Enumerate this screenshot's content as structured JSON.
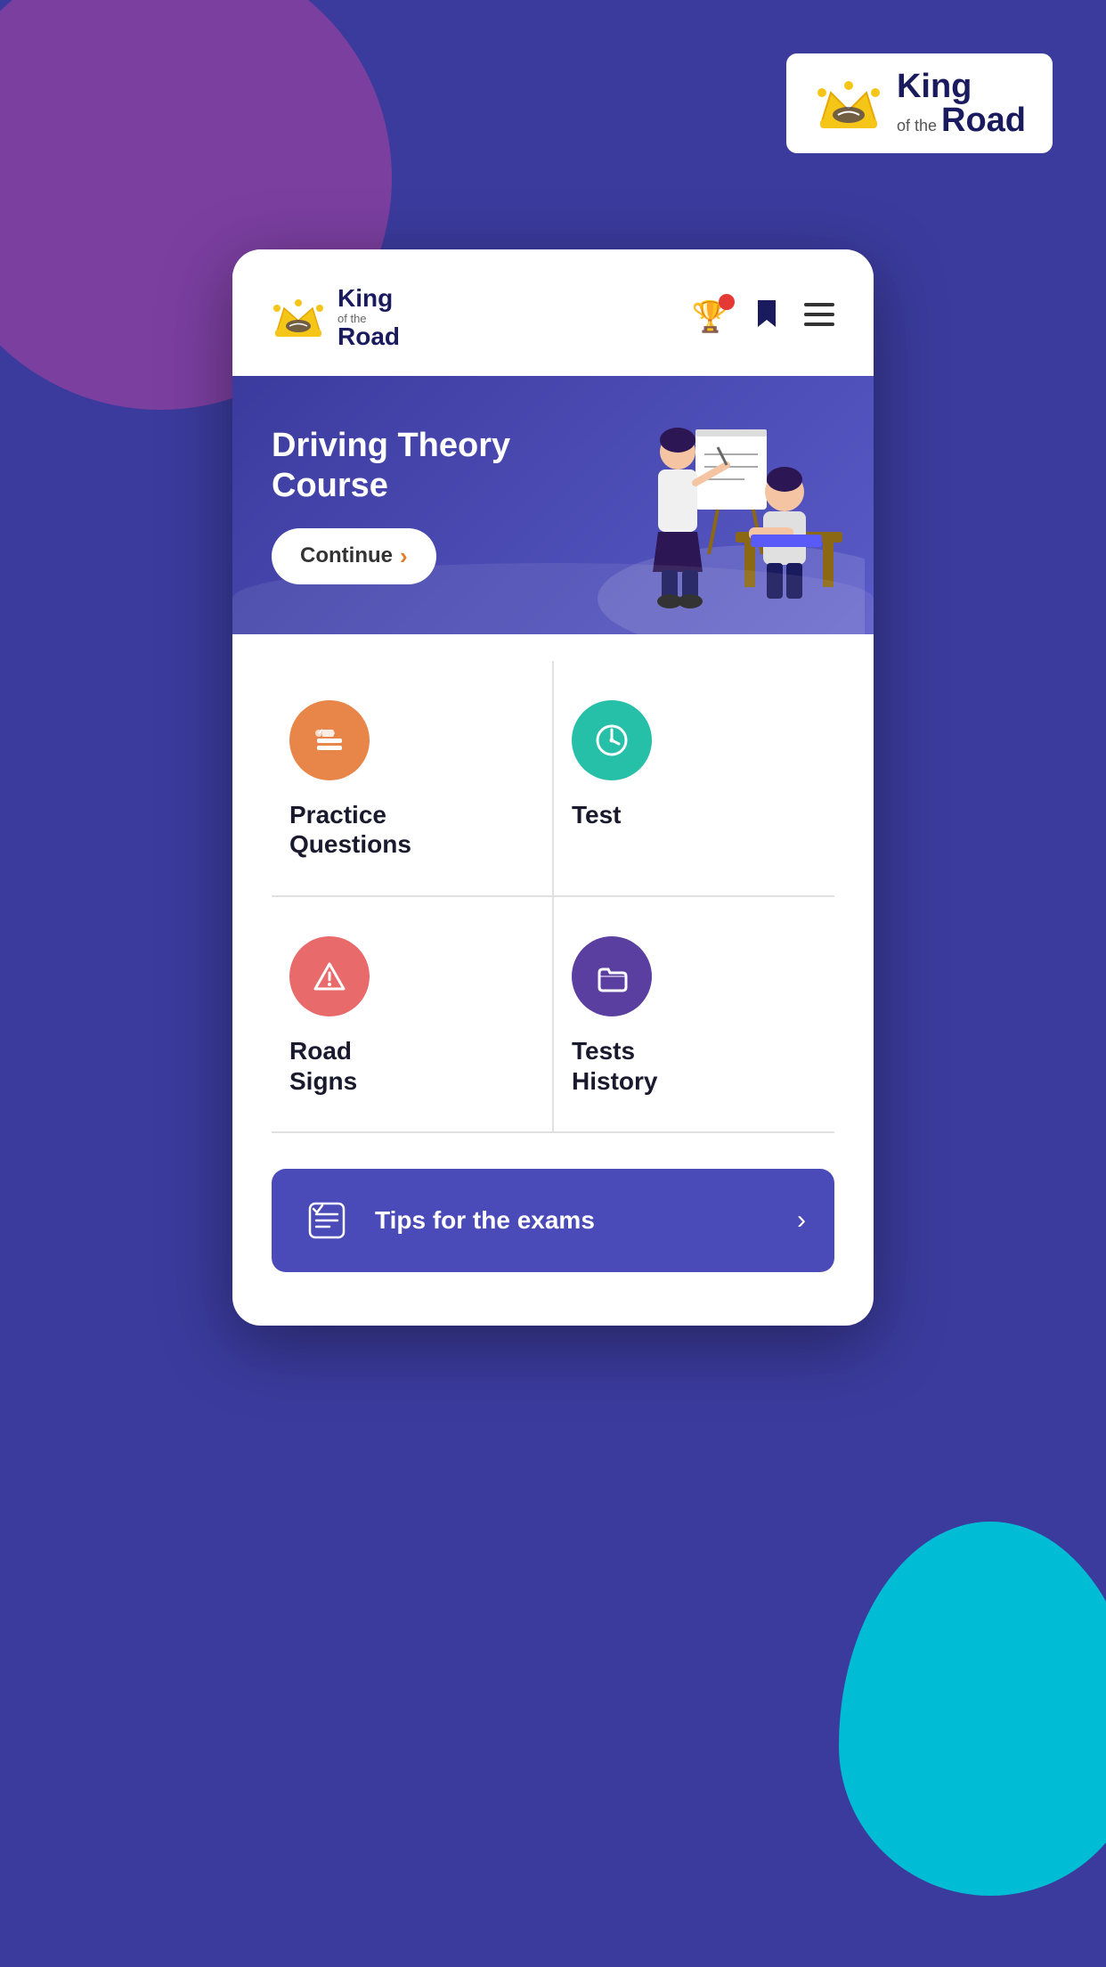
{
  "background": {
    "color": "#3b3b9e"
  },
  "top_logo": {
    "brand_name": "King",
    "brand_sub": "of the",
    "brand_last": "Road",
    "crown_emoji": "👑"
  },
  "app_header": {
    "brand_name": "King",
    "brand_sub": "of the",
    "brand_last": "Road"
  },
  "banner": {
    "title_line1": "Driving Theory",
    "title_line2": "Course",
    "continue_label": "Continue",
    "continue_arrow": "›"
  },
  "menu_items": [
    {
      "id": "practice-questions",
      "label_line1": "Practice",
      "label_line2": "Questions",
      "icon_type": "pencil-circle",
      "icon_color": "orange"
    },
    {
      "id": "test",
      "label_line1": "Test",
      "label_line2": "",
      "icon_type": "clock-circle",
      "icon_color": "teal"
    },
    {
      "id": "road-signs",
      "label_line1": "Road",
      "label_line2": "Signs",
      "icon_type": "warning-circle",
      "icon_color": "coral"
    },
    {
      "id": "tests-history",
      "label_line1": "Tests",
      "label_line2": "History",
      "icon_type": "folder-circle",
      "icon_color": "purple"
    }
  ],
  "tips_banner": {
    "label": "Tips for the exams",
    "arrow": "›",
    "icon_type": "checklist"
  }
}
